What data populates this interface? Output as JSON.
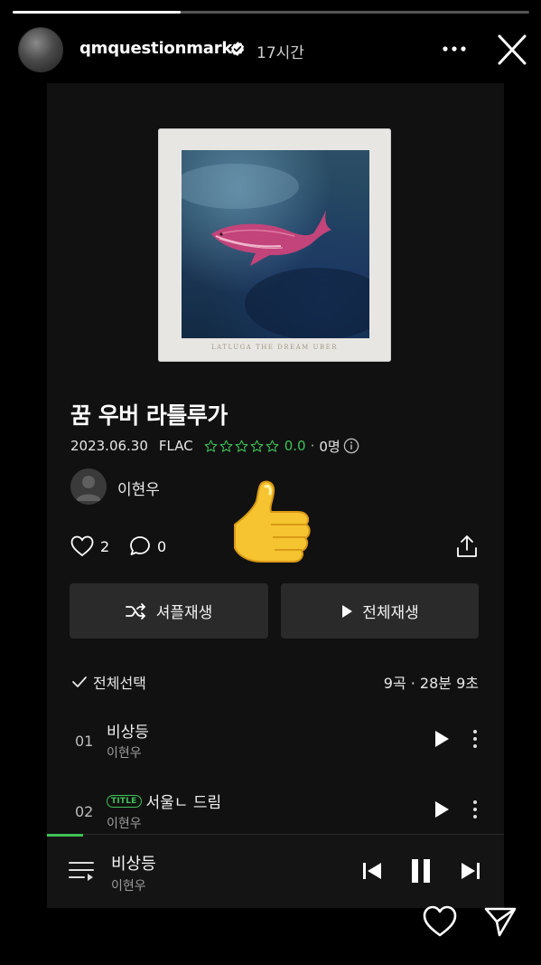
{
  "story": {
    "progress_fraction": 0.325,
    "username": "qmquestionmark",
    "time_ago": "17시간"
  },
  "album": {
    "cover_caption": "LATLUGA THE DREAM UBER",
    "title": "꿈 우버 라틀루가",
    "release_date": "2023.06.30",
    "format": "FLAC",
    "stars_filled": 0,
    "stars_total": 5,
    "rating": "0.0",
    "separator": "·",
    "rating_count": "0명",
    "artist": "이현우",
    "likes": "2",
    "comments": "0"
  },
  "actions": {
    "shuffle_label": "셔플재생",
    "play_all_label": "전체재생",
    "select_all_label": "전체선택",
    "track_summary": "9곡 · 28분 9초"
  },
  "tracks": [
    {
      "no": "01",
      "title": "비상등",
      "artist": "이현우",
      "badge": ""
    },
    {
      "no": "02",
      "title": "서울ㄴ 드림",
      "artist": "이현우",
      "badge": "TITLE"
    }
  ],
  "now_playing": {
    "title": "비상등",
    "artist": "이현우",
    "progress_fraction": 0.08
  },
  "colors": {
    "accent_green": "#3ec256",
    "background": "#000000",
    "panel": "#111111",
    "button": "#2a2a2a"
  },
  "icons": [
    "verified-badge-icon",
    "more-icon",
    "close-icon",
    "star-icon",
    "info-icon",
    "person-icon",
    "thumbs-up-sticker",
    "heart-icon",
    "comment-icon",
    "share-icon",
    "shuffle-icon",
    "play-icon",
    "check-icon",
    "kebab-icon",
    "queue-icon",
    "previous-icon",
    "pause-icon",
    "next-icon",
    "send-icon"
  ]
}
